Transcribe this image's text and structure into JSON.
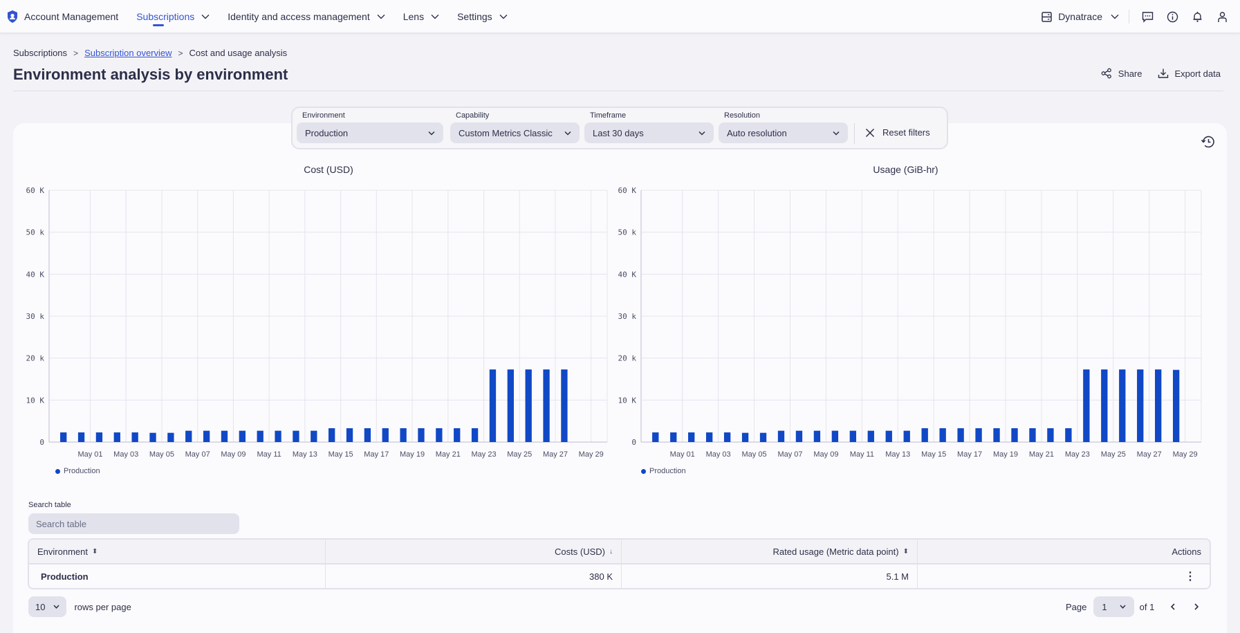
{
  "nav": {
    "brand": "Account Management",
    "items": [
      {
        "label": "Subscriptions",
        "active": true
      },
      {
        "label": "Identity and access management",
        "active": false
      },
      {
        "label": "Lens",
        "active": false
      },
      {
        "label": "Settings",
        "active": false
      }
    ],
    "environment": "Dynatrace",
    "icons": [
      "feedback-icon",
      "info-icon",
      "notifications-icon",
      "user-icon"
    ]
  },
  "breadcrumb": {
    "items": [
      "Subscriptions",
      "Subscription overview",
      "Cost and usage analysis"
    ]
  },
  "page": {
    "title": "Environment analysis by environment",
    "share_label": "Share",
    "export_label": "Export data"
  },
  "filters": {
    "environment": {
      "label": "Environment",
      "value": "Production"
    },
    "capability": {
      "label": "Capability",
      "value": "Custom Metrics Classic"
    },
    "timeframe": {
      "label": "Timeframe",
      "value": "Last 30 days"
    },
    "resolution": {
      "label": "Resolution",
      "value": "Auto resolution"
    },
    "reset_label": "Reset filters"
  },
  "colors": {
    "accent": "#3454d1",
    "bar": "#1048c6"
  },
  "chart_data": [
    {
      "type": "bar",
      "title": "Cost (USD)",
      "xlabel": "",
      "ylabel": "",
      "ylim": [
        0,
        60000
      ],
      "yticks": [
        0,
        10000,
        20000,
        30000,
        40000,
        50000,
        60000
      ],
      "ytick_labels": [
        "0",
        "10 K",
        "20 k",
        "30 k",
        "40 K",
        "50 k",
        "60 K"
      ],
      "xtick_labels": [
        "May 01",
        "May 03",
        "May 05",
        "May 07",
        "May 09",
        "May 11",
        "May 13",
        "May 15",
        "May 17",
        "May 19",
        "May 21",
        "May 23",
        "May 25",
        "May 27",
        "May 29"
      ],
      "grid": true,
      "legend": "bottom-left",
      "categories": [
        "Apr 30",
        "May 01",
        "May 02",
        "May 03",
        "May 04",
        "May 05",
        "May 06",
        "May 07",
        "May 08",
        "May 09",
        "May 10",
        "May 11",
        "May 12",
        "May 13",
        "May 14",
        "May 15",
        "May 16",
        "May 17",
        "May 18",
        "May 19",
        "May 20",
        "May 21",
        "May 22",
        "May 23",
        "May 24",
        "May 25",
        "May 26",
        "May 27",
        "May 28",
        "May 29"
      ],
      "series": [
        {
          "name": "Production",
          "values": [
            2300,
            2300,
            2300,
            2300,
            2300,
            2200,
            2200,
            2700,
            2700,
            2700,
            2700,
            2700,
            2700,
            2700,
            2700,
            3300,
            3300,
            3300,
            3300,
            3300,
            3300,
            3300,
            3300,
            3300,
            17300,
            17300,
            17300,
            17300,
            17300,
            0
          ]
        }
      ]
    },
    {
      "type": "bar",
      "title": "Usage (GiB-hr)",
      "xlabel": "",
      "ylabel": "",
      "ylim": [
        0,
        60000
      ],
      "yticks": [
        0,
        10000,
        20000,
        30000,
        40000,
        50000,
        60000
      ],
      "ytick_labels": [
        "0",
        "10 K",
        "20 k",
        "30 k",
        "40 K",
        "50 k",
        "60 K"
      ],
      "xtick_labels": [
        "May 01",
        "May 03",
        "May 05",
        "May 07",
        "May 09",
        "May 11",
        "May 13",
        "May 15",
        "May 17",
        "May 19",
        "May 21",
        "May 23",
        "May 25",
        "May 27",
        "May 29"
      ],
      "grid": true,
      "legend": "bottom-left",
      "categories": [
        "Apr 30",
        "May 01",
        "May 02",
        "May 03",
        "May 04",
        "May 05",
        "May 06",
        "May 07",
        "May 08",
        "May 09",
        "May 10",
        "May 11",
        "May 12",
        "May 13",
        "May 14",
        "May 15",
        "May 16",
        "May 17",
        "May 18",
        "May 19",
        "May 20",
        "May 21",
        "May 22",
        "May 23",
        "May 24",
        "May 25",
        "May 26",
        "May 27",
        "May 28",
        "May 29",
        "May 30"
      ],
      "series": [
        {
          "name": "Production",
          "values": [
            2300,
            2300,
            2300,
            2300,
            2300,
            2200,
            2200,
            2700,
            2700,
            2700,
            2700,
            2700,
            2700,
            2700,
            2700,
            3300,
            3300,
            3300,
            3300,
            3300,
            3300,
            3300,
            3300,
            3300,
            17300,
            17300,
            17300,
            17300,
            17300,
            17200,
            0
          ]
        }
      ]
    }
  ],
  "table": {
    "search_label": "Search table",
    "search_placeholder": "Search table",
    "columns": [
      {
        "label": "Environment",
        "sort": "both"
      },
      {
        "label": "Costs (USD)",
        "sort": "desc"
      },
      {
        "label": "Rated usage (Metric data point)",
        "sort": "both"
      },
      {
        "label": "Actions",
        "sort": "none"
      }
    ],
    "rows": [
      {
        "environment": "Production",
        "costs": "380 K",
        "rated_usage": "5.1 M"
      }
    ]
  },
  "pagination": {
    "rows_per_page": "10",
    "rows_per_page_label": "rows per page",
    "page_label": "Page",
    "current_page": "1",
    "of_label": "of 1"
  }
}
